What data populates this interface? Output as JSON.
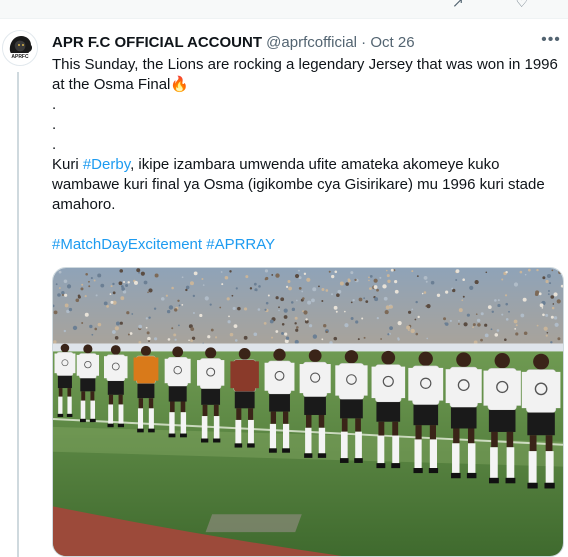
{
  "tweet": {
    "display_name": "APR F.C OFFICIAL ACCOUNT",
    "handle": "@aprfcofficial",
    "separator": "·",
    "date": "Oct 26",
    "more_label": "•••",
    "avatar_text": "APRFC",
    "line1": "This Sunday, the Lions are rocking a legendary Jersey that was won in 1996 at the Osma Final",
    "fire_emoji": "🔥",
    "dot1": ".",
    "dot2": ".",
    "dot3": ".",
    "kuri_prefix": "Kuri ",
    "derby_tag": "#Derby",
    "kuri_rest": ", ikipe izambara umwenda ufite amateka akomeye kuko wambawe kuri final ya Osma (igikombe cya Gisirikare) mu 1996 kuri stade amahoro.",
    "tag_matchday": "#MatchDayExcitement",
    "tag_aprray": "#APRRAY"
  },
  "photo": {
    "description_icon": "team-photo-image",
    "players": 15
  },
  "colors": {
    "link": "#1d9bf0",
    "text": "#0f1419",
    "muted": "#536471",
    "pitch": "#4f7d3b",
    "jersey": "#f2f2f2",
    "shorts": "#1a1a1a"
  }
}
